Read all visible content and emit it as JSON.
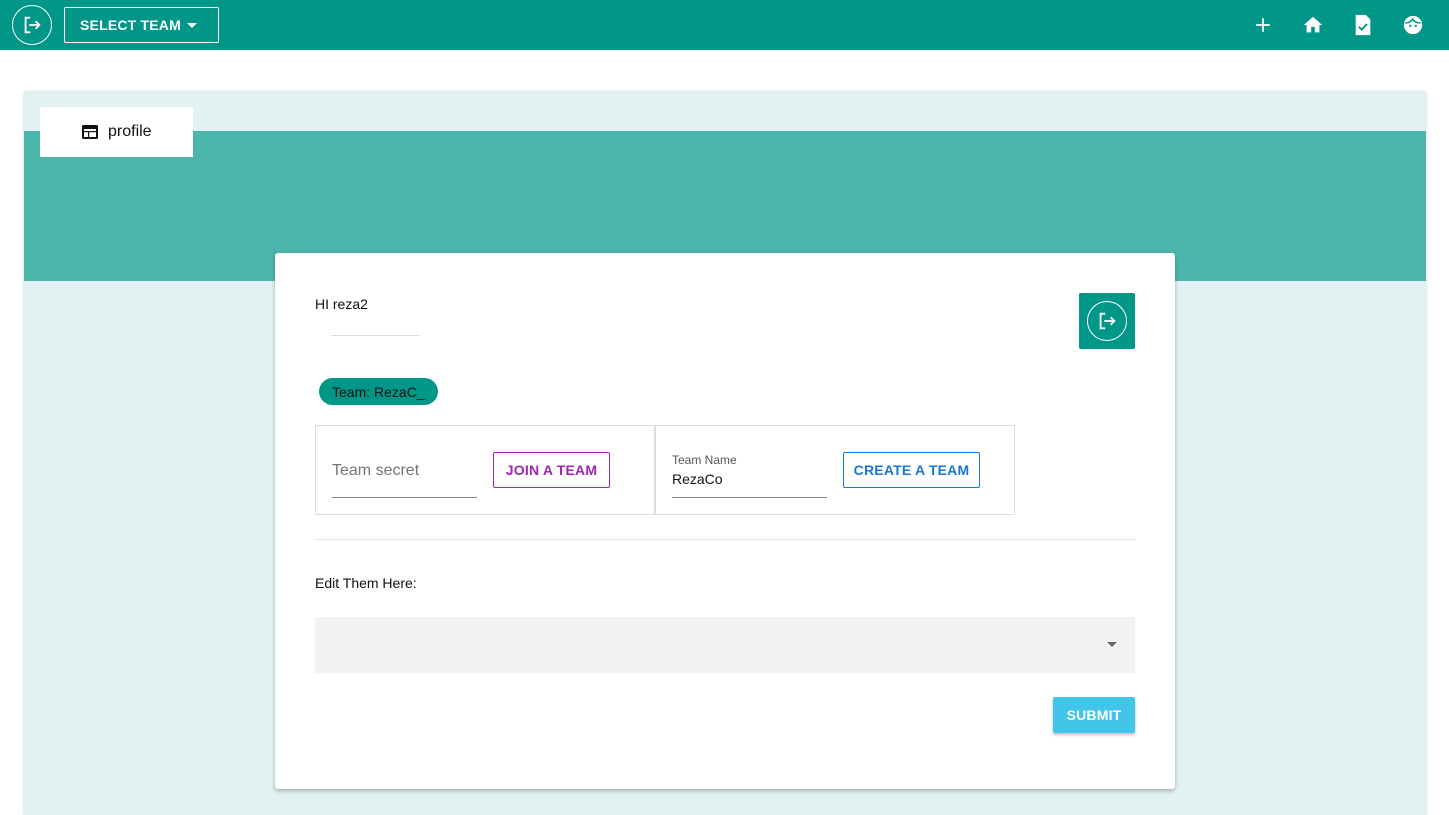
{
  "appbar": {
    "team_select_label": "SELECT TEAM",
    "icons": [
      "logout-icon",
      "add-icon",
      "home-icon",
      "task-document-icon",
      "face-icon"
    ],
    "color": "#009688"
  },
  "tab": {
    "label": "profile",
    "icon": "web-icon"
  },
  "profile": {
    "greeting": "HI reza2",
    "team_chip": "Team: RezaC_",
    "join": {
      "secret_placeholder": "Team secret",
      "button": "JOIN A TEAM"
    },
    "create": {
      "name_label": "Team Name",
      "name_value": "RezaCo",
      "button": "CREATE A TEAM"
    },
    "edit_label": "Edit Them Here:",
    "select_value": "",
    "submit": "SUBMIT"
  },
  "colors": {
    "accent": "#009688",
    "band": "#4db6ac",
    "panel_bg": "#e0f2f1",
    "join": "#9c27b0",
    "create": "#1976d2",
    "submit": "#42c5e8"
  }
}
